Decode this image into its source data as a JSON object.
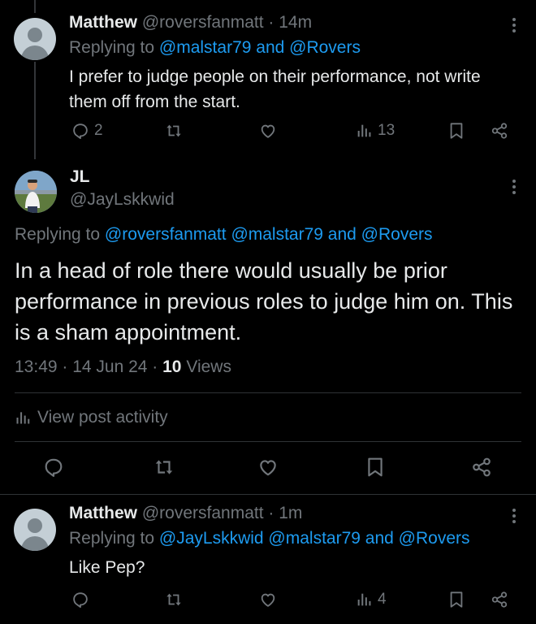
{
  "reply1": {
    "name": "Matthew",
    "handle": "@roversfanmatt",
    "time": "· 14m",
    "replying_prefix": "Replying to",
    "mentions": "@malstar79 and @Rovers",
    "text": "I prefer to judge people on their performance, not write them off from the start.",
    "replies_count": "2",
    "views_count": "13"
  },
  "main": {
    "name": "JL",
    "handle": "@JayLskkwid",
    "replying_prefix": "Replying to",
    "mentions": "@roversfanmatt @malstar79 and @Rovers",
    "text": "In a head of role there would usually be prior performance in previous roles to judge him on. This is a sham appointment.",
    "timestamp": "13:49 · 14 Jun 24 · ",
    "views_count": "10",
    "views_label": " Views",
    "activity_label": "View post activity"
  },
  "reply2": {
    "name": "Matthew",
    "handle": "@roversfanmatt",
    "time": "· 1m",
    "replying_prefix": "Replying to",
    "mentions": "@JayLskkwid @malstar79 and @Rovers",
    "text": "Like Pep?",
    "views_count": "4"
  },
  "colors": {
    "background": "#000000",
    "text": "#e7e9ea",
    "secondary": "#71767b",
    "accent": "#1d9bf0",
    "divider": "#2f3336"
  },
  "icons": [
    "reply-icon",
    "repost-icon",
    "like-icon",
    "views-icon",
    "bookmark-icon",
    "share-icon",
    "more-icon",
    "activity-icon"
  ]
}
